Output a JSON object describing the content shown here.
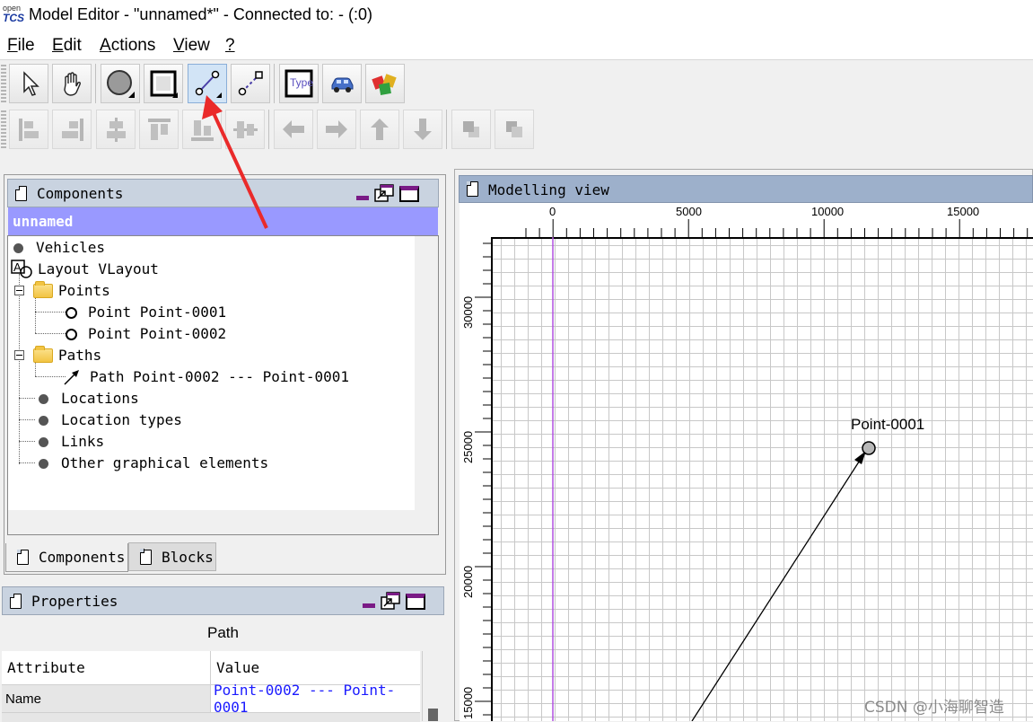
{
  "app": {
    "logo_top": "open",
    "logo_bottom": "TCS",
    "window_title": "Model Editor - \"unnamed*\" - Connected to: - (:0)"
  },
  "menu": [
    {
      "label": "File",
      "mnemonic": "F",
      "rest": "ile"
    },
    {
      "label": "Edit",
      "mnemonic": "E",
      "rest": "dit"
    },
    {
      "label": "Actions",
      "mnemonic": "A",
      "rest": "ctions"
    },
    {
      "label": "View",
      "mnemonic": "V",
      "rest": "iew"
    },
    {
      "label": "?",
      "mnemonic": "?",
      "rest": ""
    }
  ],
  "toolbar1": {
    "buttons": [
      {
        "name": "select-tool-button",
        "icon": "arrow-cursor-icon"
      },
      {
        "name": "drag-tool-button",
        "icon": "hand-icon"
      },
      {
        "name": "create-point-button",
        "icon": "point-circle-icon"
      },
      {
        "name": "create-location-button",
        "icon": "location-square-icon"
      },
      {
        "name": "create-path-button",
        "icon": "path-line-icon",
        "selected": true
      },
      {
        "name": "create-link-button",
        "icon": "link-dashed-icon"
      },
      {
        "name": "create-location-type-button",
        "icon": "type-icon",
        "text": "Type"
      },
      {
        "name": "create-vehicle-button",
        "icon": "vehicle-car-icon"
      },
      {
        "name": "create-block-button",
        "icon": "block-cubes-icon"
      }
    ]
  },
  "toolbar2": {
    "buttons": [
      {
        "name": "align-left-button",
        "icon": "align-left-icon"
      },
      {
        "name": "align-right-button",
        "icon": "align-right-icon"
      },
      {
        "name": "align-center-horizontal-button",
        "icon": "align-center-h-icon"
      },
      {
        "name": "align-top-button",
        "icon": "align-top-icon"
      },
      {
        "name": "align-bottom-button",
        "icon": "align-bottom-icon"
      },
      {
        "name": "align-center-vertical-button",
        "icon": "align-center-v-icon"
      },
      {
        "name": "move-left-button",
        "icon": "arrow-left-icon"
      },
      {
        "name": "move-right-button",
        "icon": "arrow-right-icon"
      },
      {
        "name": "move-up-button",
        "icon": "arrow-up-icon"
      },
      {
        "name": "move-down-button",
        "icon": "arrow-down-icon"
      },
      {
        "name": "bring-to-front-button",
        "icon": "bring-front-icon"
      },
      {
        "name": "send-to-back-button",
        "icon": "send-back-icon"
      }
    ]
  },
  "components_panel": {
    "title": "Components",
    "model_name": "unnamed",
    "tree": {
      "vehicles": "Vehicles",
      "layout": "Layout VLayout",
      "points": "Points",
      "point1": "Point Point-0001",
      "point2": "Point Point-0002",
      "paths": "Paths",
      "path1": "Path Point-0002 --- Point-0001",
      "locations": "Locations",
      "location_types": "Location types",
      "links": "Links",
      "other": "Other graphical elements"
    },
    "tabs": {
      "components": "Components",
      "blocks": "Blocks"
    }
  },
  "properties_panel": {
    "title": "Properties",
    "object_type": "Path",
    "col_attribute": "Attribute",
    "col_value": "Value",
    "rows": [
      {
        "attribute": "Name",
        "value": "Point-0002 --- Point-0001"
      }
    ]
  },
  "modelling_view": {
    "title": "Modelling view",
    "x_ticks": [
      "0",
      "5000",
      "10000",
      "15000"
    ],
    "y_ticks": [
      "30000",
      "25000",
      "20000",
      "15000"
    ],
    "point_label": "Point-0001",
    "accent_color": "#9b4dca"
  },
  "watermark": "CSDN @小海聊智造"
}
